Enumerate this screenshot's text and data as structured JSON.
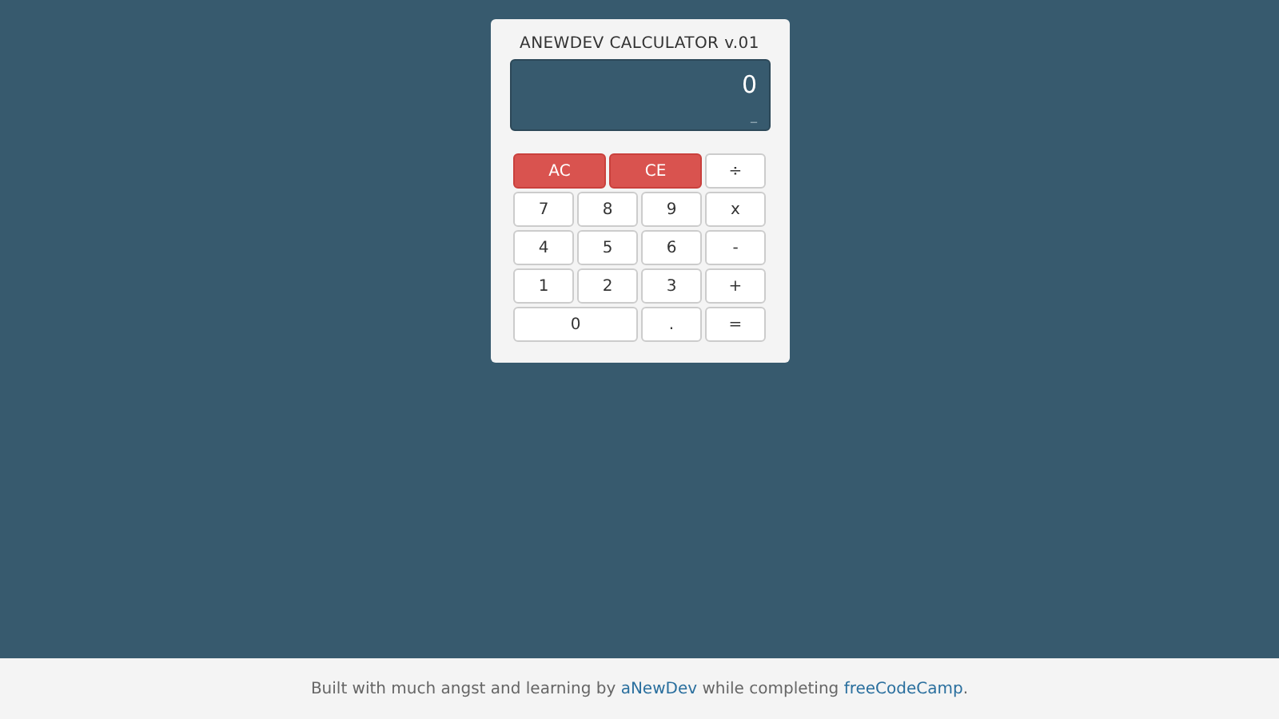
{
  "calculator": {
    "title": "ANEWDEV CALCULATOR v.01",
    "display": {
      "value": "0",
      "history": "_"
    },
    "keys": [
      {
        "label": "AC",
        "kind": "clear",
        "wide": true
      },
      {
        "label": "CE",
        "kind": "clear",
        "wide": true
      },
      {
        "label": "÷",
        "kind": "key",
        "wide": false
      },
      {
        "label": "7",
        "kind": "key",
        "wide": false
      },
      {
        "label": "8",
        "kind": "key",
        "wide": false
      },
      {
        "label": "9",
        "kind": "key",
        "wide": false
      },
      {
        "label": "x",
        "kind": "key",
        "wide": false
      },
      {
        "label": "4",
        "kind": "key",
        "wide": false
      },
      {
        "label": "5",
        "kind": "key",
        "wide": false
      },
      {
        "label": "6",
        "kind": "key",
        "wide": false
      },
      {
        "label": "-",
        "kind": "key",
        "wide": false
      },
      {
        "label": "1",
        "kind": "key",
        "wide": false
      },
      {
        "label": "2",
        "kind": "key",
        "wide": false
      },
      {
        "label": "3",
        "kind": "key",
        "wide": false
      },
      {
        "label": "+",
        "kind": "key",
        "wide": false
      },
      {
        "label": "0",
        "kind": "key",
        "wide": true
      },
      {
        "label": ".",
        "kind": "key",
        "wide": false
      },
      {
        "label": "=",
        "kind": "key",
        "wide": false
      }
    ]
  },
  "footer": {
    "parts": [
      {
        "kind": "text",
        "text": "Built with much angst and learning by "
      },
      {
        "kind": "link",
        "text": "aNewDev"
      },
      {
        "kind": "text",
        "text": " while completing "
      },
      {
        "kind": "link",
        "text": "freeCodeCamp"
      },
      {
        "kind": "text",
        "text": "."
      }
    ]
  }
}
